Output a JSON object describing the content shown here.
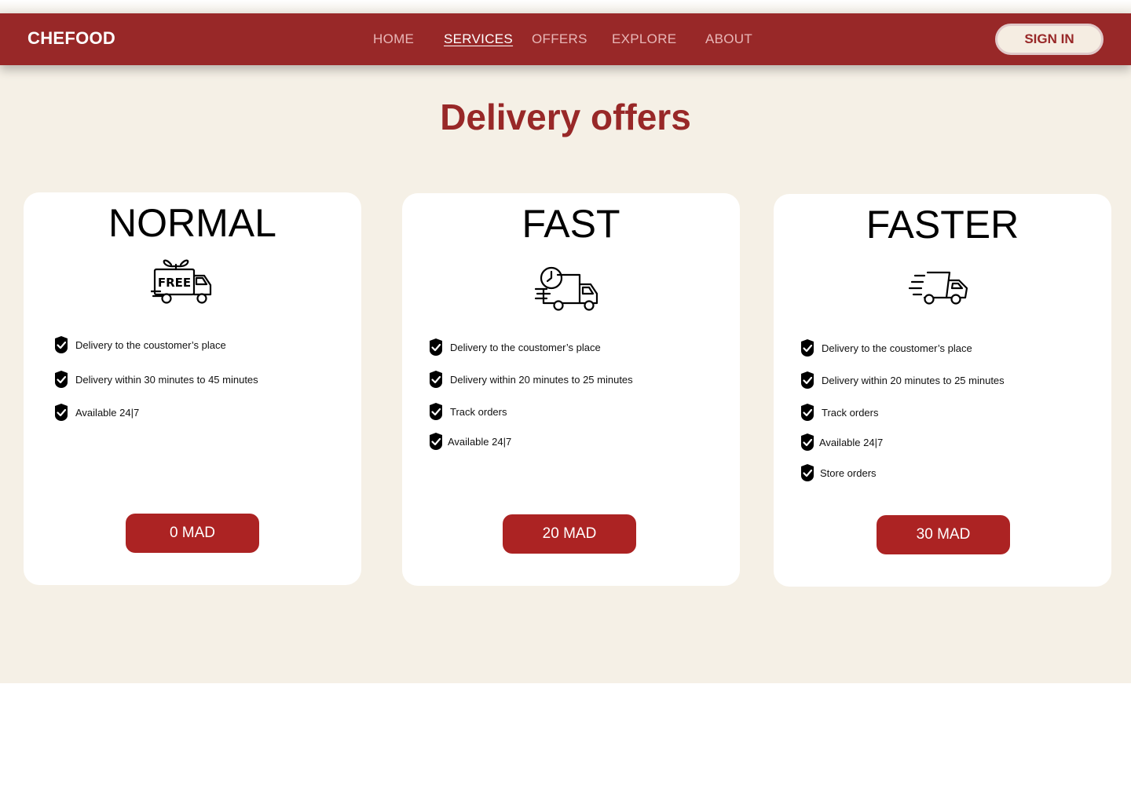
{
  "nav": {
    "brand": "CHEFOOD",
    "items": [
      {
        "label": "HOME"
      },
      {
        "label": "SERVICES"
      },
      {
        "label": "OFFERS"
      },
      {
        "label": "EXPLORE"
      },
      {
        "label": "ABOUT"
      }
    ],
    "signin_label": "SIGN IN"
  },
  "page": {
    "title": "Delivery offers"
  },
  "cards": [
    {
      "name": "NORMAL",
      "icon": "free-delivery-truck-icon",
      "icon_text": "FREE",
      "features": [
        "Delivery to the coustomer’s place",
        "Delivery within 30 minutes to 45 minutes",
        "Available 24|7"
      ],
      "price": "0 MAD"
    },
    {
      "name": "FAST",
      "icon": "clock-delivery-truck-icon",
      "features": [
        "Delivery to the coustomer’s place",
        "Delivery within 20 minutes to 25 minutes",
        "Track orders",
        "Available 24|7"
      ],
      "price": "20 MAD"
    },
    {
      "name": "FASTER",
      "icon": "speeding-truck-icon",
      "features": [
        "Delivery to the coustomer’s place",
        "Delivery within 20 minutes to 25 minutes",
        "Track orders",
        "Available 24|7",
        "Store orders"
      ],
      "price": "30 MAD"
    }
  ],
  "colors": {
    "brand": "#982828",
    "button": "#ac2323",
    "background": "#f5f0e6"
  }
}
